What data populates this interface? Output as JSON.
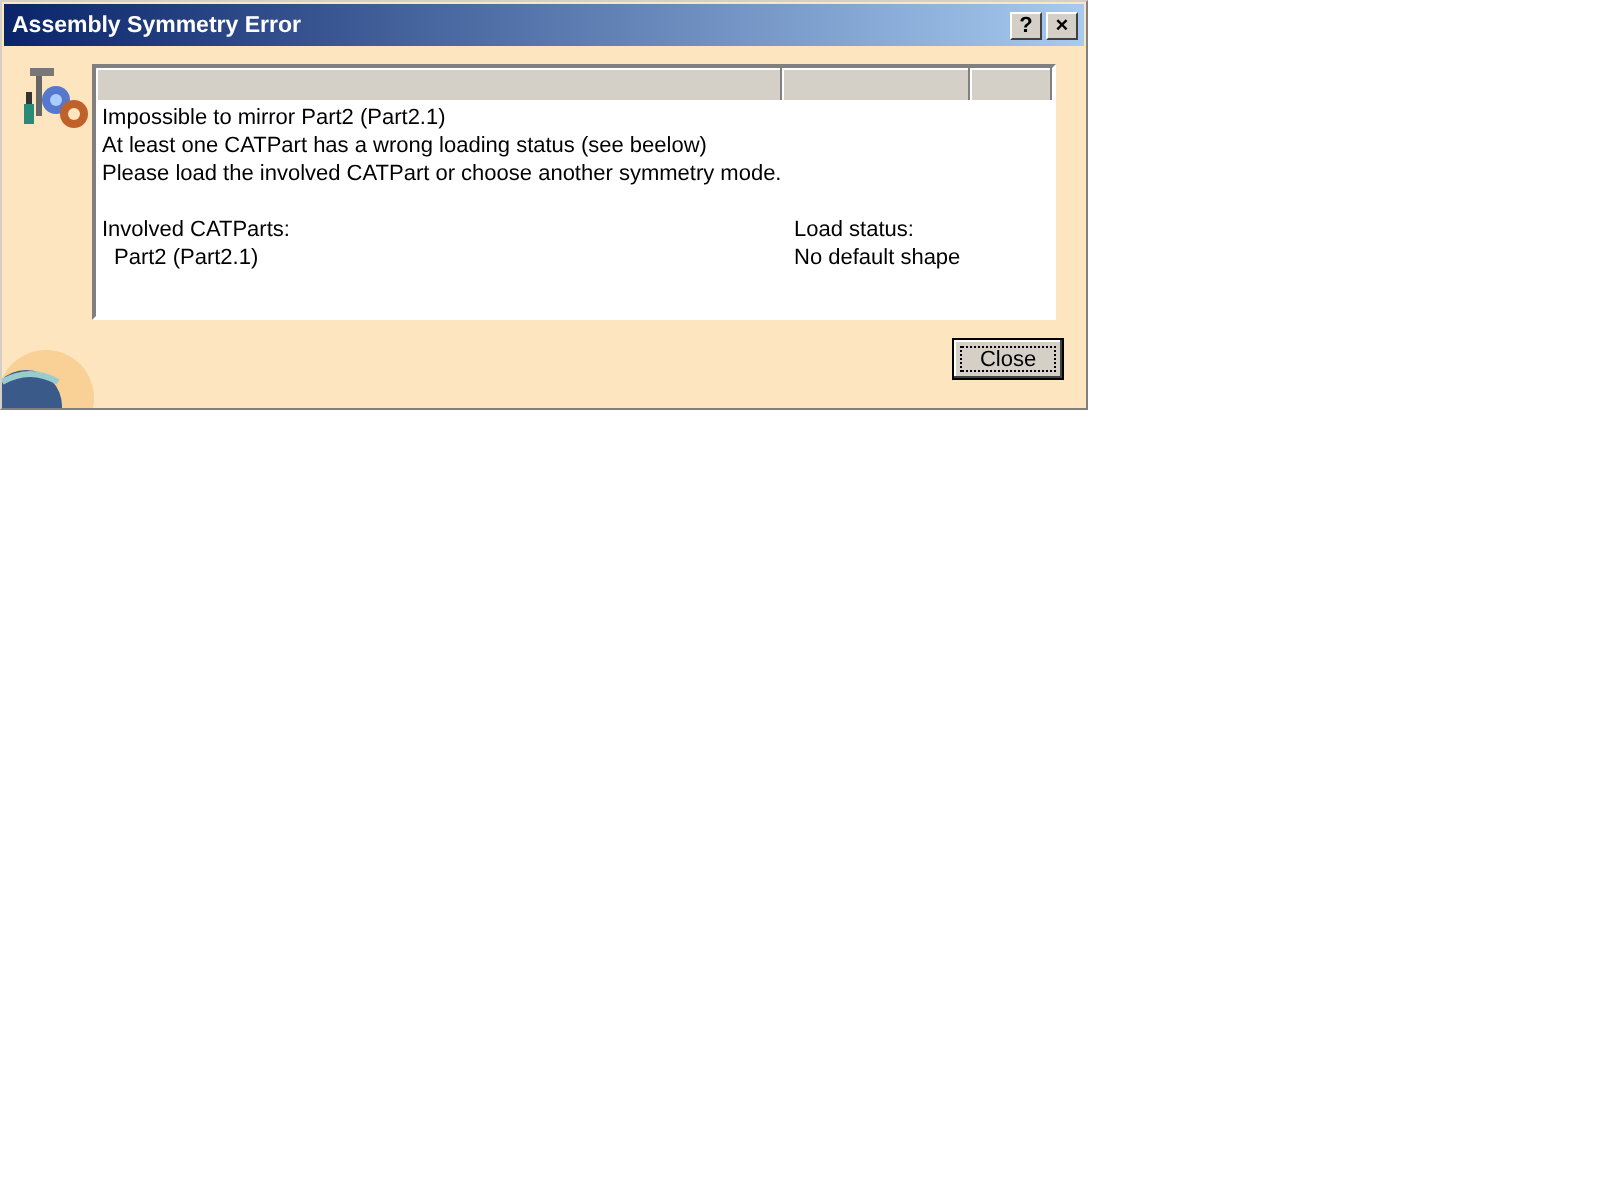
{
  "window": {
    "title": "Assembly Symmetry Error",
    "buttons": [
      "?",
      "×"
    ]
  },
  "message": [
    "Impossible to mirror Part2 (Part2.1)",
    "At least one CATPart has a wrong loading status (see beelow)",
    "Please load the involved CATPart or choose another symmetry mode."
  ],
  "parts": {
    "heading": "Involved CATParts:",
    "items": [
      "Part2 (Part2.1)"
    ]
  },
  "status": {
    "heading": "Load status:",
    "items": [
      "No default shape"
    ]
  },
  "close_button": "Close"
}
